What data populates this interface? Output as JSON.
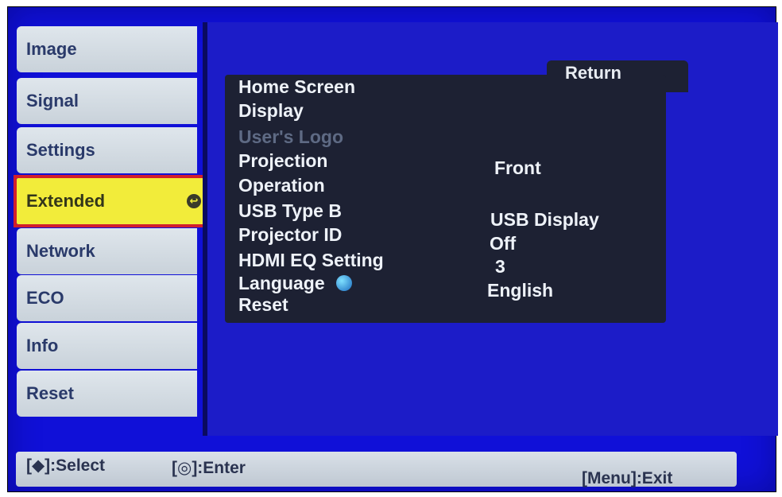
{
  "sidebar": {
    "items": [
      {
        "label": "Image"
      },
      {
        "label": "Signal"
      },
      {
        "label": "Settings"
      },
      {
        "label": "Extended",
        "selected": true
      },
      {
        "label": "Network"
      },
      {
        "label": "ECO"
      },
      {
        "label": "Info"
      },
      {
        "label": "Reset"
      }
    ]
  },
  "submenu": {
    "return_label": "Return",
    "items": [
      {
        "label": "Home Screen",
        "value": ""
      },
      {
        "label": "Display",
        "value": ""
      },
      {
        "label": "User's Logo",
        "value": "",
        "disabled": true
      },
      {
        "label": "Projection",
        "value": "Front"
      },
      {
        "label": "Operation",
        "value": ""
      },
      {
        "label": "USB Type B",
        "value": "USB Display"
      },
      {
        "label": "Projector ID",
        "value": "Off"
      },
      {
        "label": "HDMI EQ Setting",
        "value": "3"
      },
      {
        "label": "Language",
        "value": "English"
      },
      {
        "label": "Reset",
        "value": ""
      }
    ]
  },
  "statusbar": {
    "select_hint": "[◆]:Select",
    "enter_hint": "[◎]:Enter",
    "exit_hint": "[Menu]:Exit"
  },
  "colors": {
    "background": "#1010d8",
    "tab": "#d4dbe2",
    "tab_selected": "#f2ec3a",
    "highlight_border": "#d21e2c",
    "menu_box": "#1d2133",
    "disabled_text": "#5e6a84"
  }
}
